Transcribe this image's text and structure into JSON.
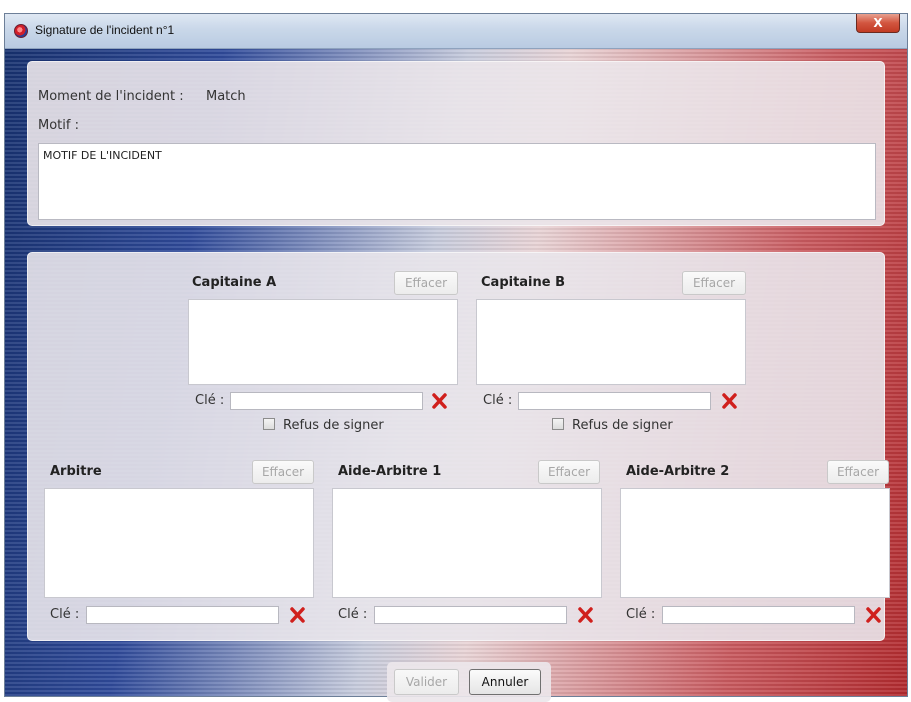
{
  "window": {
    "title": "Signature de l'incident n°1",
    "close_label": "X"
  },
  "incident": {
    "moment_label": "Moment de l'incident :",
    "moment_value": "Match",
    "motif_label": "Motif :",
    "motif_value": "MOTIF DE L'INCIDENT"
  },
  "signatures": {
    "effacer_label": "Effacer",
    "cle_label": "Clé :",
    "refus_label": "Refus de signer",
    "capitaine_a": "Capitaine A",
    "capitaine_b": "Capitaine B",
    "arbitre": "Arbitre",
    "aide_arbitre_1": "Aide-Arbitre 1",
    "aide_arbitre_2": "Aide-Arbitre 2"
  },
  "footer": {
    "valider_label": "Valider",
    "annuler_label": "Annuler"
  },
  "colors": {
    "accent_red": "#d0201d",
    "disabled_text": "#a7a7a7"
  }
}
